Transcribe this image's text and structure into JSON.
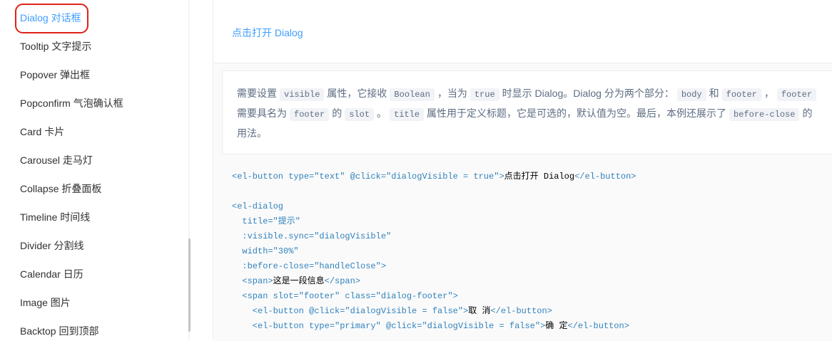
{
  "sidebar": {
    "items": [
      {
        "label": "Dialog 对话框",
        "active": true
      },
      {
        "label": "Tooltip 文字提示"
      },
      {
        "label": "Popover 弹出框"
      },
      {
        "label": "Popconfirm 气泡确认框"
      },
      {
        "label": "Card 卡片"
      },
      {
        "label": "Carousel 走马灯"
      },
      {
        "label": "Collapse 折叠面板"
      },
      {
        "label": "Timeline 时间线"
      },
      {
        "label": "Divider 分割线"
      },
      {
        "label": "Calendar 日历"
      },
      {
        "label": "Image 图片"
      },
      {
        "label": "Backtop 回到顶部"
      }
    ]
  },
  "demo": {
    "link_label": "点击打开 Dialog"
  },
  "description": {
    "t1": "需要设置",
    "c1": "visible",
    "t2": "属性，它接收",
    "c2": "Boolean",
    "t3": "，当为",
    "c3": "true",
    "t4": "时显示 Dialog。Dialog 分为两个部分：",
    "c4": "body",
    "t5": "和",
    "c5": "footer",
    "t6": "，",
    "c6": "footer",
    "t7": "需要具名为",
    "c7": "footer",
    "t8": "的",
    "c8": "slot",
    "t9": "。",
    "c9": "title",
    "t10": "属性用于定义标题，它是可选的，默认值为空。最后，本例还展示了",
    "c10": "before-close",
    "t11": "的用法。"
  },
  "code": {
    "l1_open": "<el-button type=\"text\" @click=\"dialogVisible = true\">",
    "l1_text": "点击打开 Dialog",
    "l1_close": "</el-button>",
    "l3": "<el-dialog",
    "l4": "  title=\"提示\"",
    "l5": "  :visible.sync=\"dialogVisible\"",
    "l6": "  width=\"30%\"",
    "l7": "  :before-close=\"handleClose\">",
    "l8_open": "  <span>",
    "l8_text": "这是一段信息",
    "l8_close": "</span>",
    "l9": "  <span slot=\"footer\" class=\"dialog-footer\">",
    "l10_open": "    <el-button @click=\"dialogVisible = false\">",
    "l10_text": "取 消",
    "l10_close": "</el-button>",
    "l11_open": "    <el-button type=\"primary\" @click=\"dialogVisible = false\">",
    "l11_text": "确 定",
    "l11_close": "</el-button>"
  },
  "colors": {
    "accent": "#409eff",
    "highlight_ring": "#e0201a",
    "code_tag": "#3182bd"
  }
}
